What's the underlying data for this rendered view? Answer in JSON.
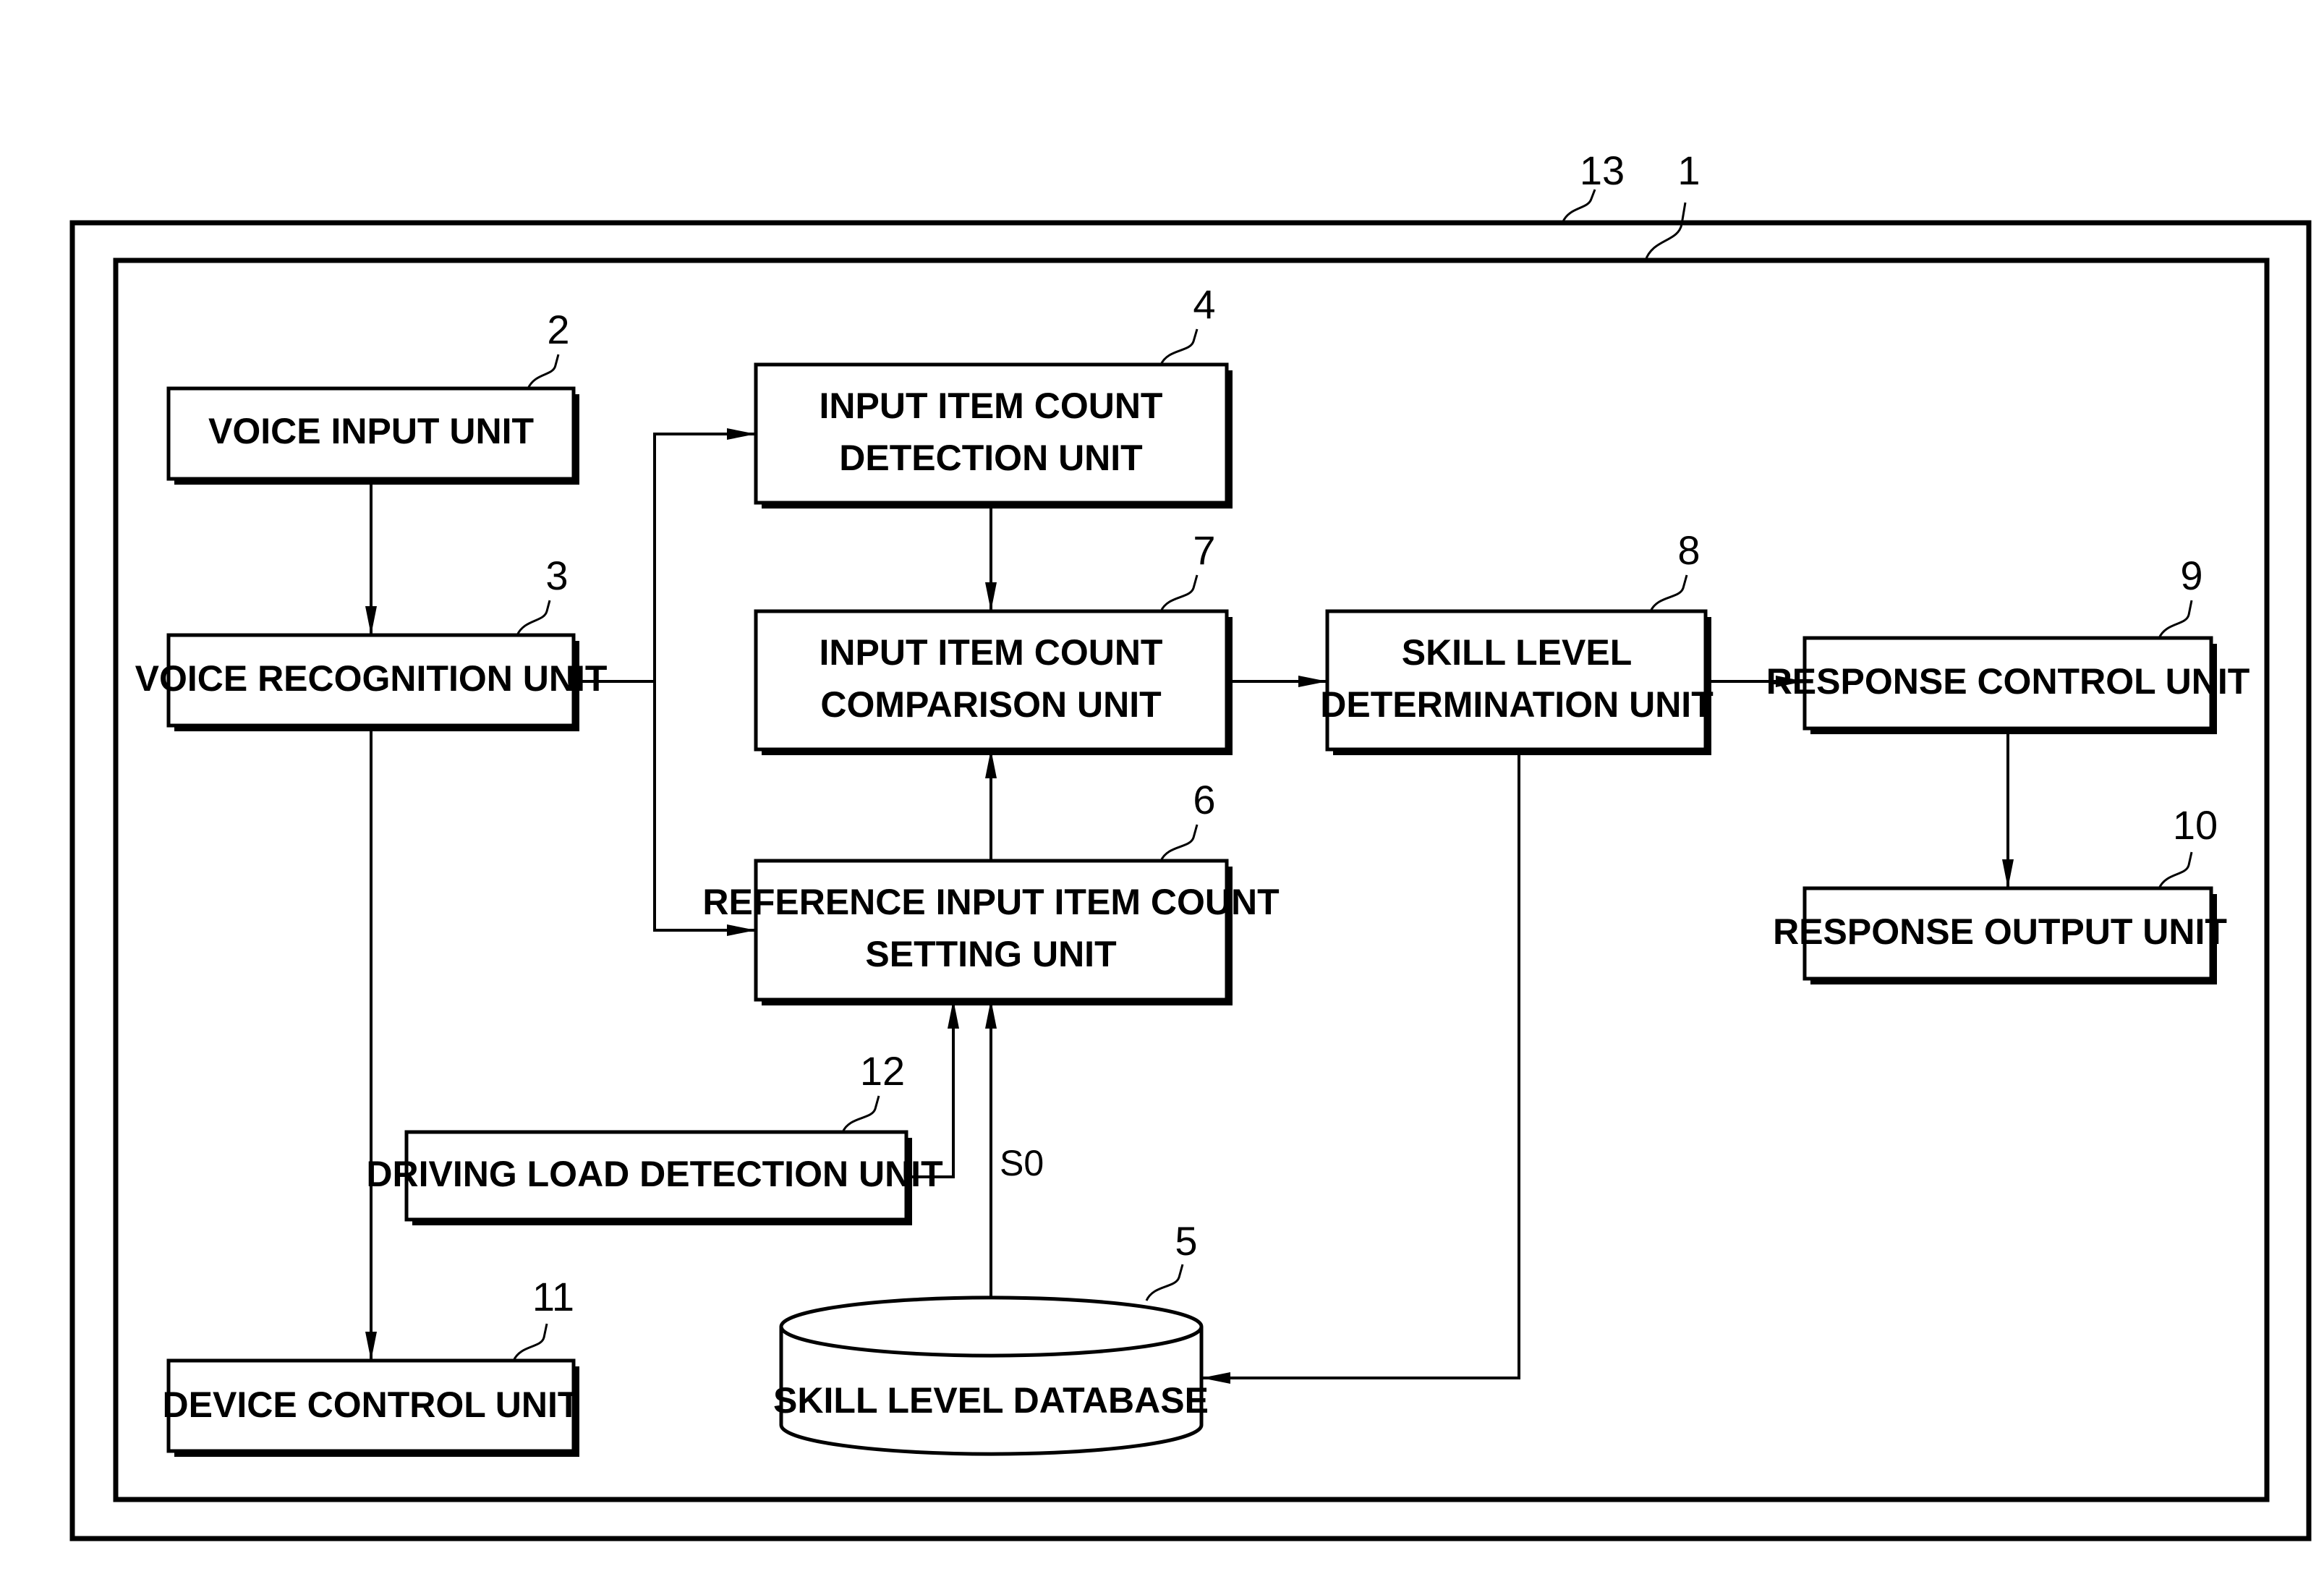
{
  "diagram": {
    "frames": [
      {
        "ref": "13",
        "label": ""
      },
      {
        "ref": "1",
        "label": ""
      }
    ],
    "blocks": [
      {
        "id": "voice-input",
        "ref": "2",
        "lines": [
          "VOICE INPUT UNIT"
        ]
      },
      {
        "id": "voice-recognition",
        "ref": "3",
        "lines": [
          "VOICE RECOGNITION UNIT"
        ]
      },
      {
        "id": "input-item-count-detection",
        "ref": "4",
        "lines": [
          "INPUT ITEM COUNT",
          "DETECTION UNIT"
        ]
      },
      {
        "id": "input-item-count-comparison",
        "ref": "7",
        "lines": [
          "INPUT ITEM COUNT",
          "COMPARISON UNIT"
        ]
      },
      {
        "id": "reference-input-item-count-setting",
        "ref": "6",
        "lines": [
          "REFERENCE INPUT ITEM COUNT",
          "SETTING UNIT"
        ]
      },
      {
        "id": "skill-level-determination",
        "ref": "8",
        "lines": [
          "SKILL LEVEL",
          "DETERMINATION UNIT"
        ]
      },
      {
        "id": "response-control",
        "ref": "9",
        "lines": [
          "RESPONSE CONTROL UNIT"
        ]
      },
      {
        "id": "response-output",
        "ref": "10",
        "lines": [
          "RESPONSE OUTPUT UNIT"
        ]
      },
      {
        "id": "driving-load-detection",
        "ref": "12",
        "lines": [
          "DRIVING LOAD DETECTION UNIT"
        ]
      },
      {
        "id": "device-control",
        "ref": "11",
        "lines": [
          "DEVICE CONTROL UNIT"
        ]
      },
      {
        "id": "skill-level-database",
        "ref": "5",
        "lines": [
          "SKILL LEVEL DATABASE"
        ],
        "shape": "cylinder"
      }
    ],
    "signals": {
      "database_to_setting": "S0"
    },
    "connections": [
      {
        "from": "voice-input",
        "to": "voice-recognition"
      },
      {
        "from": "voice-recognition",
        "to": "input-item-count-detection"
      },
      {
        "from": "voice-recognition",
        "to": "reference-input-item-count-setting"
      },
      {
        "from": "voice-recognition",
        "to": "device-control"
      },
      {
        "from": "input-item-count-detection",
        "to": "input-item-count-comparison"
      },
      {
        "from": "reference-input-item-count-setting",
        "to": "input-item-count-comparison"
      },
      {
        "from": "input-item-count-comparison",
        "to": "skill-level-determination"
      },
      {
        "from": "skill-level-determination",
        "to": "response-control"
      },
      {
        "from": "skill-level-determination",
        "to": "skill-level-database"
      },
      {
        "from": "response-control",
        "to": "response-output"
      },
      {
        "from": "driving-load-detection",
        "to": "reference-input-item-count-setting"
      },
      {
        "from": "skill-level-database",
        "to": "reference-input-item-count-setting",
        "signal": "S0"
      }
    ]
  }
}
